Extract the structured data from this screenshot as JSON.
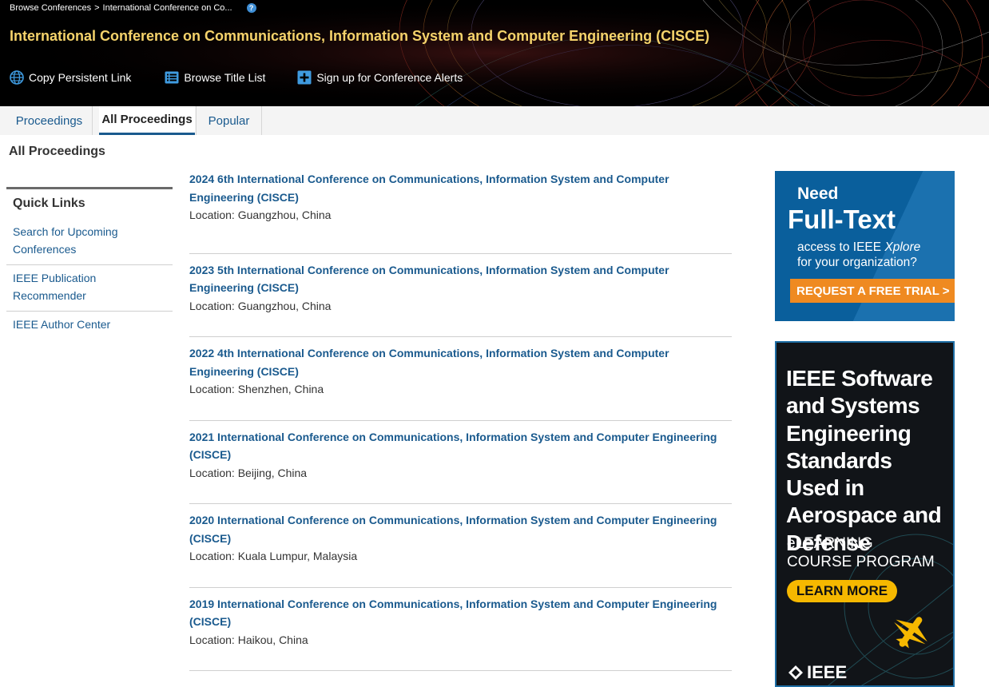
{
  "breadcrumb": {
    "root": "Browse Conferences",
    "separator": ">",
    "current": "International Conference on Co...",
    "help": "?"
  },
  "conference": {
    "title": "International Conference on Communications, Information System and Computer Engineering (CISCE)"
  },
  "actions": {
    "copy_link": "Copy Persistent Link",
    "browse_titles": "Browse Title List",
    "alerts": "Sign up for Conference Alerts"
  },
  "tabs": [
    {
      "label": "Proceedings"
    },
    {
      "label": "All Proceedings"
    },
    {
      "label": "Popular"
    }
  ],
  "section_title": "All Proceedings",
  "quick_links": {
    "title": "Quick Links",
    "items": [
      {
        "label": "Search for Upcoming Conferences"
      },
      {
        "label": "IEEE Publication Recommender"
      },
      {
        "label": "IEEE Author Center"
      }
    ]
  },
  "proceedings": [
    {
      "title": "2024 6th International Conference on Communications, Information System and Computer Engineering (CISCE)",
      "location": "Location: Guangzhou, China"
    },
    {
      "title": "2023 5th International Conference on Communications, Information System and Computer Engineering (CISCE)",
      "location": "Location: Guangzhou, China"
    },
    {
      "title": "2022 4th International Conference on Communications, Information System and Computer Engineering (CISCE)",
      "location": "Location: Shenzhen, China"
    },
    {
      "title": "2021 International Conference on Communications, Information System and Computer Engineering (CISCE)",
      "location": "Location: Beijing, China"
    },
    {
      "title": "2020 International Conference on Communications, Information System and Computer Engineering (CISCE)",
      "location": "Location: Kuala Lumpur, Malaysia"
    },
    {
      "title": "2019 International Conference on Communications, Information System and Computer Engineering (CISCE)",
      "location": "Location: Haikou, China"
    }
  ],
  "ads": {
    "fulltext": {
      "need": "Need",
      "headline": "Full-Text",
      "body_1": "access to IEEE",
      "body_brand": "Xplore",
      "body_2": "for your organization?",
      "cta": "REQUEST A FREE TRIAL >"
    },
    "course": {
      "headline": "IEEE Software and Systems Engineering Standards Used in Aerospace and Defense",
      "subline": "eLEARNING COURSE PROGRAM",
      "cta": "LEARN MORE",
      "logo": "IEEE"
    }
  },
  "colors": {
    "link": "#1a5a8e",
    "title_gold": "#f5d36b",
    "ad_blue": "#0a5f9c",
    "ad_orange": "#ef8a21",
    "ad_yellow": "#f6b800"
  }
}
